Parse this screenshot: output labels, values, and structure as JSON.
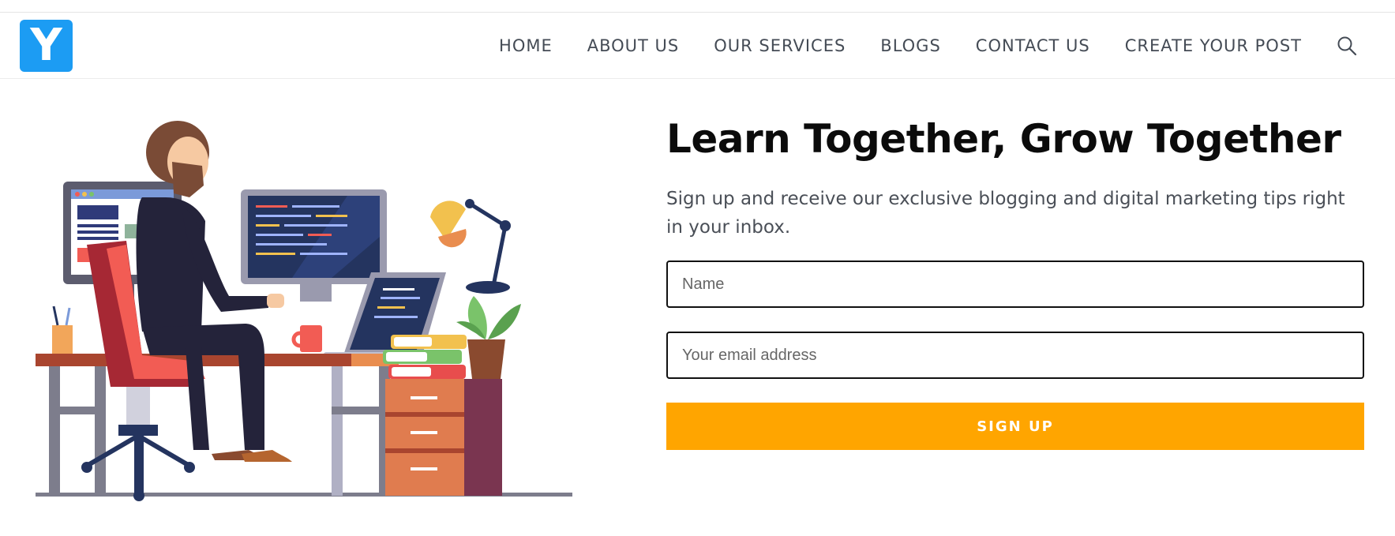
{
  "logo": {
    "letter": "Y",
    "color": "#1c9cf3"
  },
  "nav": {
    "items": [
      "HOME",
      "ABOUT US",
      "OUR SERVICES",
      "BLOGS",
      "CONTACT US",
      "CREATE YOUR POST"
    ],
    "search_icon": "search-icon"
  },
  "hero": {
    "illustration": "developer-at-desk-illustration",
    "title": "Learn Together, Grow Together",
    "subtitle": "Sign up and receive our exclusive blogging and digital marketing tips right in your inbox.",
    "form": {
      "name_placeholder": "Name",
      "name_value": "",
      "email_placeholder": "Your email address",
      "email_value": "",
      "submit_label": "SIGN UP",
      "button_color": "#ffa500"
    }
  }
}
